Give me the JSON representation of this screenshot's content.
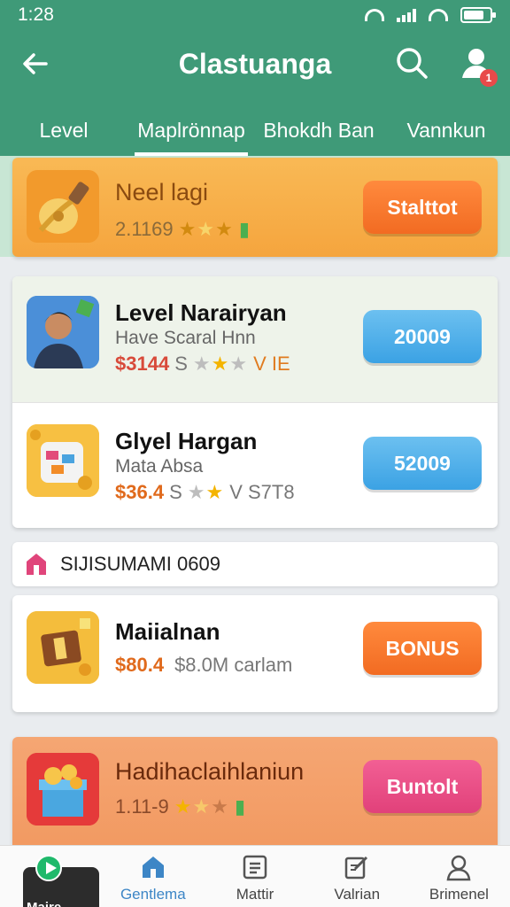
{
  "status_bar": {
    "time": "1:28"
  },
  "app_bar": {
    "title": "Clastuanga",
    "notification_count": "1"
  },
  "tabs": [
    {
      "label": "Level"
    },
    {
      "label": "Maplrönnap",
      "active": true
    },
    {
      "label": "Bhokdh Ban"
    },
    {
      "label": "Vannkun"
    }
  ],
  "featured": {
    "name": "Neel lagi",
    "meta": "2.1169",
    "button": "Stalttot"
  },
  "items": [
    {
      "name": "Level Narairyan",
      "sub": "Have Scaral Hnn",
      "price": "$3144",
      "meta_left": "S",
      "meta_right": "V IE",
      "button": "20009",
      "button_color": "#3ba2e4"
    },
    {
      "name": "Glyel Hargan",
      "sub": "Mata Absa",
      "price": "$36.4",
      "meta_left": "S",
      "meta_right": "V S7T8",
      "button": "52009",
      "button_color": "#3ba2e4"
    }
  ],
  "section": {
    "label": "SIJISUMAMI 0609"
  },
  "bonus_item": {
    "name": "Maiialnan",
    "price": "$80.4",
    "meta": "$8.0M carlam",
    "button": "BONUS"
  },
  "promo_item": {
    "name": "Hadihaclaihlaniun",
    "meta": "1.11-9",
    "button": "Buntolt"
  },
  "bottom_nav": {
    "mini_label": "Maire",
    "items": [
      {
        "label": "Gentlema",
        "icon": "home-icon",
        "active": true
      },
      {
        "label": "Mattir",
        "icon": "list-icon"
      },
      {
        "label": "Valrian",
        "icon": "edit-icon"
      },
      {
        "label": "Brimenel",
        "icon": "person-icon"
      }
    ]
  },
  "colors": {
    "header": "#3f9a78",
    "featured_bg": "#f7b04a",
    "promo_bg": "#f2a06a",
    "orange_button": "#f26b22",
    "blue_button": "#3ba2e4",
    "pink_button": "#e1417a",
    "active_nav": "#3d86c6"
  }
}
